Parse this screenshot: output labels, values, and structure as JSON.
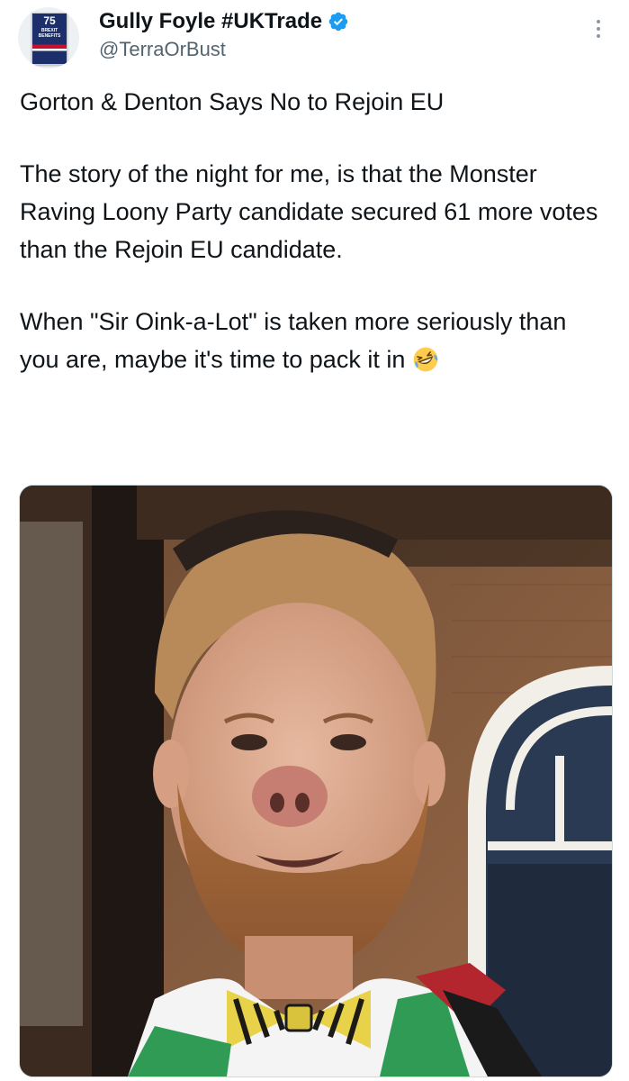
{
  "post": {
    "author": {
      "display_name": "Gully Foyle #UKTrade",
      "handle": "@TerraOrBust",
      "verified": true,
      "avatar": {
        "badge_number": "75",
        "badge_text": "BREXIT BENEFITS"
      }
    },
    "text": {
      "line_1": "Gorton & Denton Says No to Rejoin EU",
      "paragraph_2": "The story of the night for me, is that the Monster Raving Loony Party candidate secured 61 more votes than the Rejoin EU candidate.",
      "paragraph_3": "When \"Sir Oink-a-Lot\" is taken more seriously than you are, maybe it's time to pack it in",
      "emoji": "rolling-on-floor-laughing-emoji"
    },
    "media": {
      "type": "photo"
    }
  },
  "colors": {
    "text": "#0f1419",
    "secondary_text": "#536471",
    "verified_badge": "#1d9bf0",
    "media_border": "#cfd9de"
  }
}
